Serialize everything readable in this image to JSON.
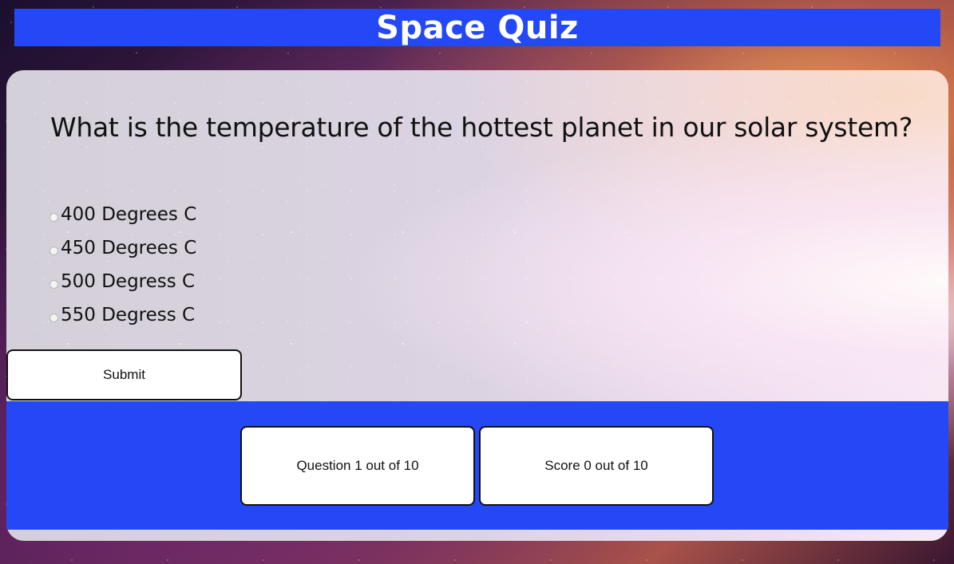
{
  "header": {
    "title": "Space Quiz"
  },
  "quiz": {
    "question": "What is the temperature of the hottest planet in our solar system?",
    "options": [
      "400 Degrees C",
      "450 Degrees C",
      "500 Degress C",
      "550 Degress C"
    ],
    "submit_label": "Submit"
  },
  "status": {
    "question_progress": "Question 1 out of 10",
    "score": "Score 0 out of 10"
  },
  "colors": {
    "accent": "#2448f5",
    "card": "#dcd3e2",
    "box": "#ffffff"
  },
  "icons": {
    "option_marker": "radio-icon"
  }
}
